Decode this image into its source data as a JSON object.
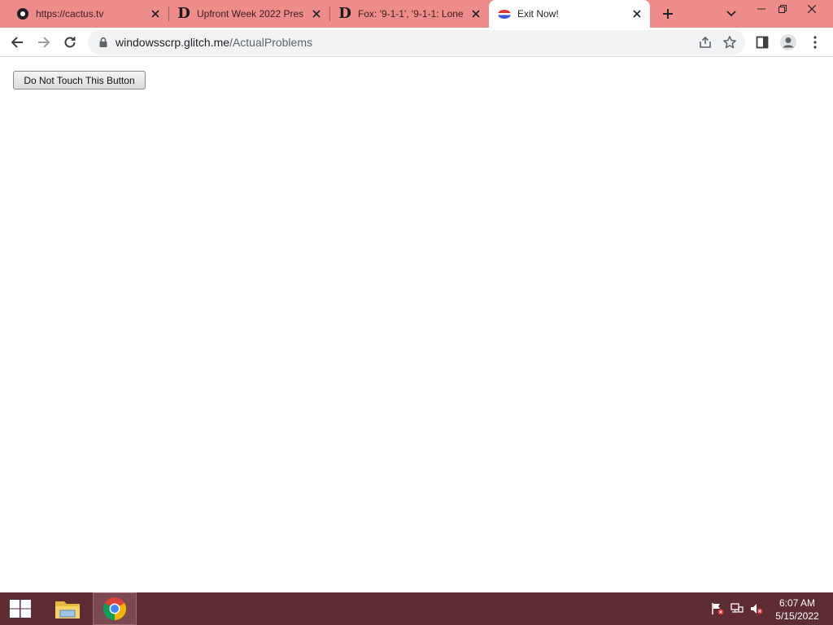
{
  "browser": {
    "tabs": [
      {
        "title": "https://cactus.tv",
        "favicon": "cactus-icon",
        "active": false
      },
      {
        "title": "Upfront Week 2022 Pres",
        "favicon": "d-logo-icon",
        "active": false
      },
      {
        "title": "Fox: '9-1-1', '9-1-1: Lone",
        "favicon": "d-logo-icon",
        "active": false
      },
      {
        "title": "Exit Now!",
        "favicon": "exit-favicon-icon",
        "active": true
      }
    ],
    "url_host": "windowsscrp.glitch.me",
    "url_path": "/ActualProblems",
    "colors": {
      "tabstrip": "#ee8c8c",
      "active_tab": "#ffffff"
    }
  },
  "page": {
    "button_label": "Do Not Touch This Button"
  },
  "taskbar": {
    "apps": [
      "file-explorer-icon",
      "chrome-icon"
    ],
    "time": "6:07 AM",
    "date": "5/15/2022",
    "color": "#5e2d34"
  }
}
